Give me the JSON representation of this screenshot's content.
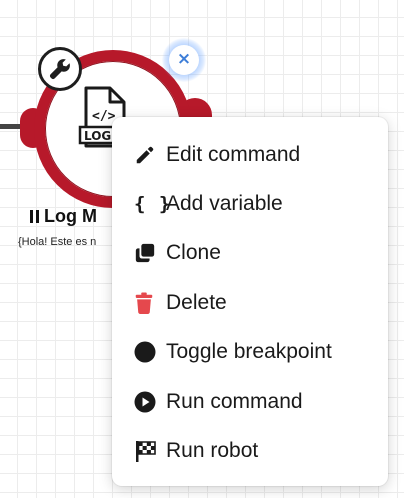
{
  "node": {
    "title": "Log M",
    "subtitle": "{Hola! Este es n",
    "icon": "log-file-icon",
    "settings_icon": "wrench-icon",
    "close_label": "×",
    "colors": {
      "ring": "#b7192a",
      "close_glow": "#73aaff"
    }
  },
  "context_menu": {
    "items": [
      {
        "label": "Edit command",
        "icon": "pencil-icon"
      },
      {
        "label": "Add variable",
        "icon": "braces-icon",
        "glyph": "{ }"
      },
      {
        "label": "Clone",
        "icon": "clone-icon"
      },
      {
        "label": "Delete",
        "icon": "trash-icon",
        "icon_color": "#e5484d"
      },
      {
        "label": "Toggle breakpoint",
        "icon": "circle-icon"
      },
      {
        "label": "Run command",
        "icon": "play-circle-icon"
      },
      {
        "label": "Run robot",
        "icon": "checkered-flag-icon"
      }
    ]
  }
}
